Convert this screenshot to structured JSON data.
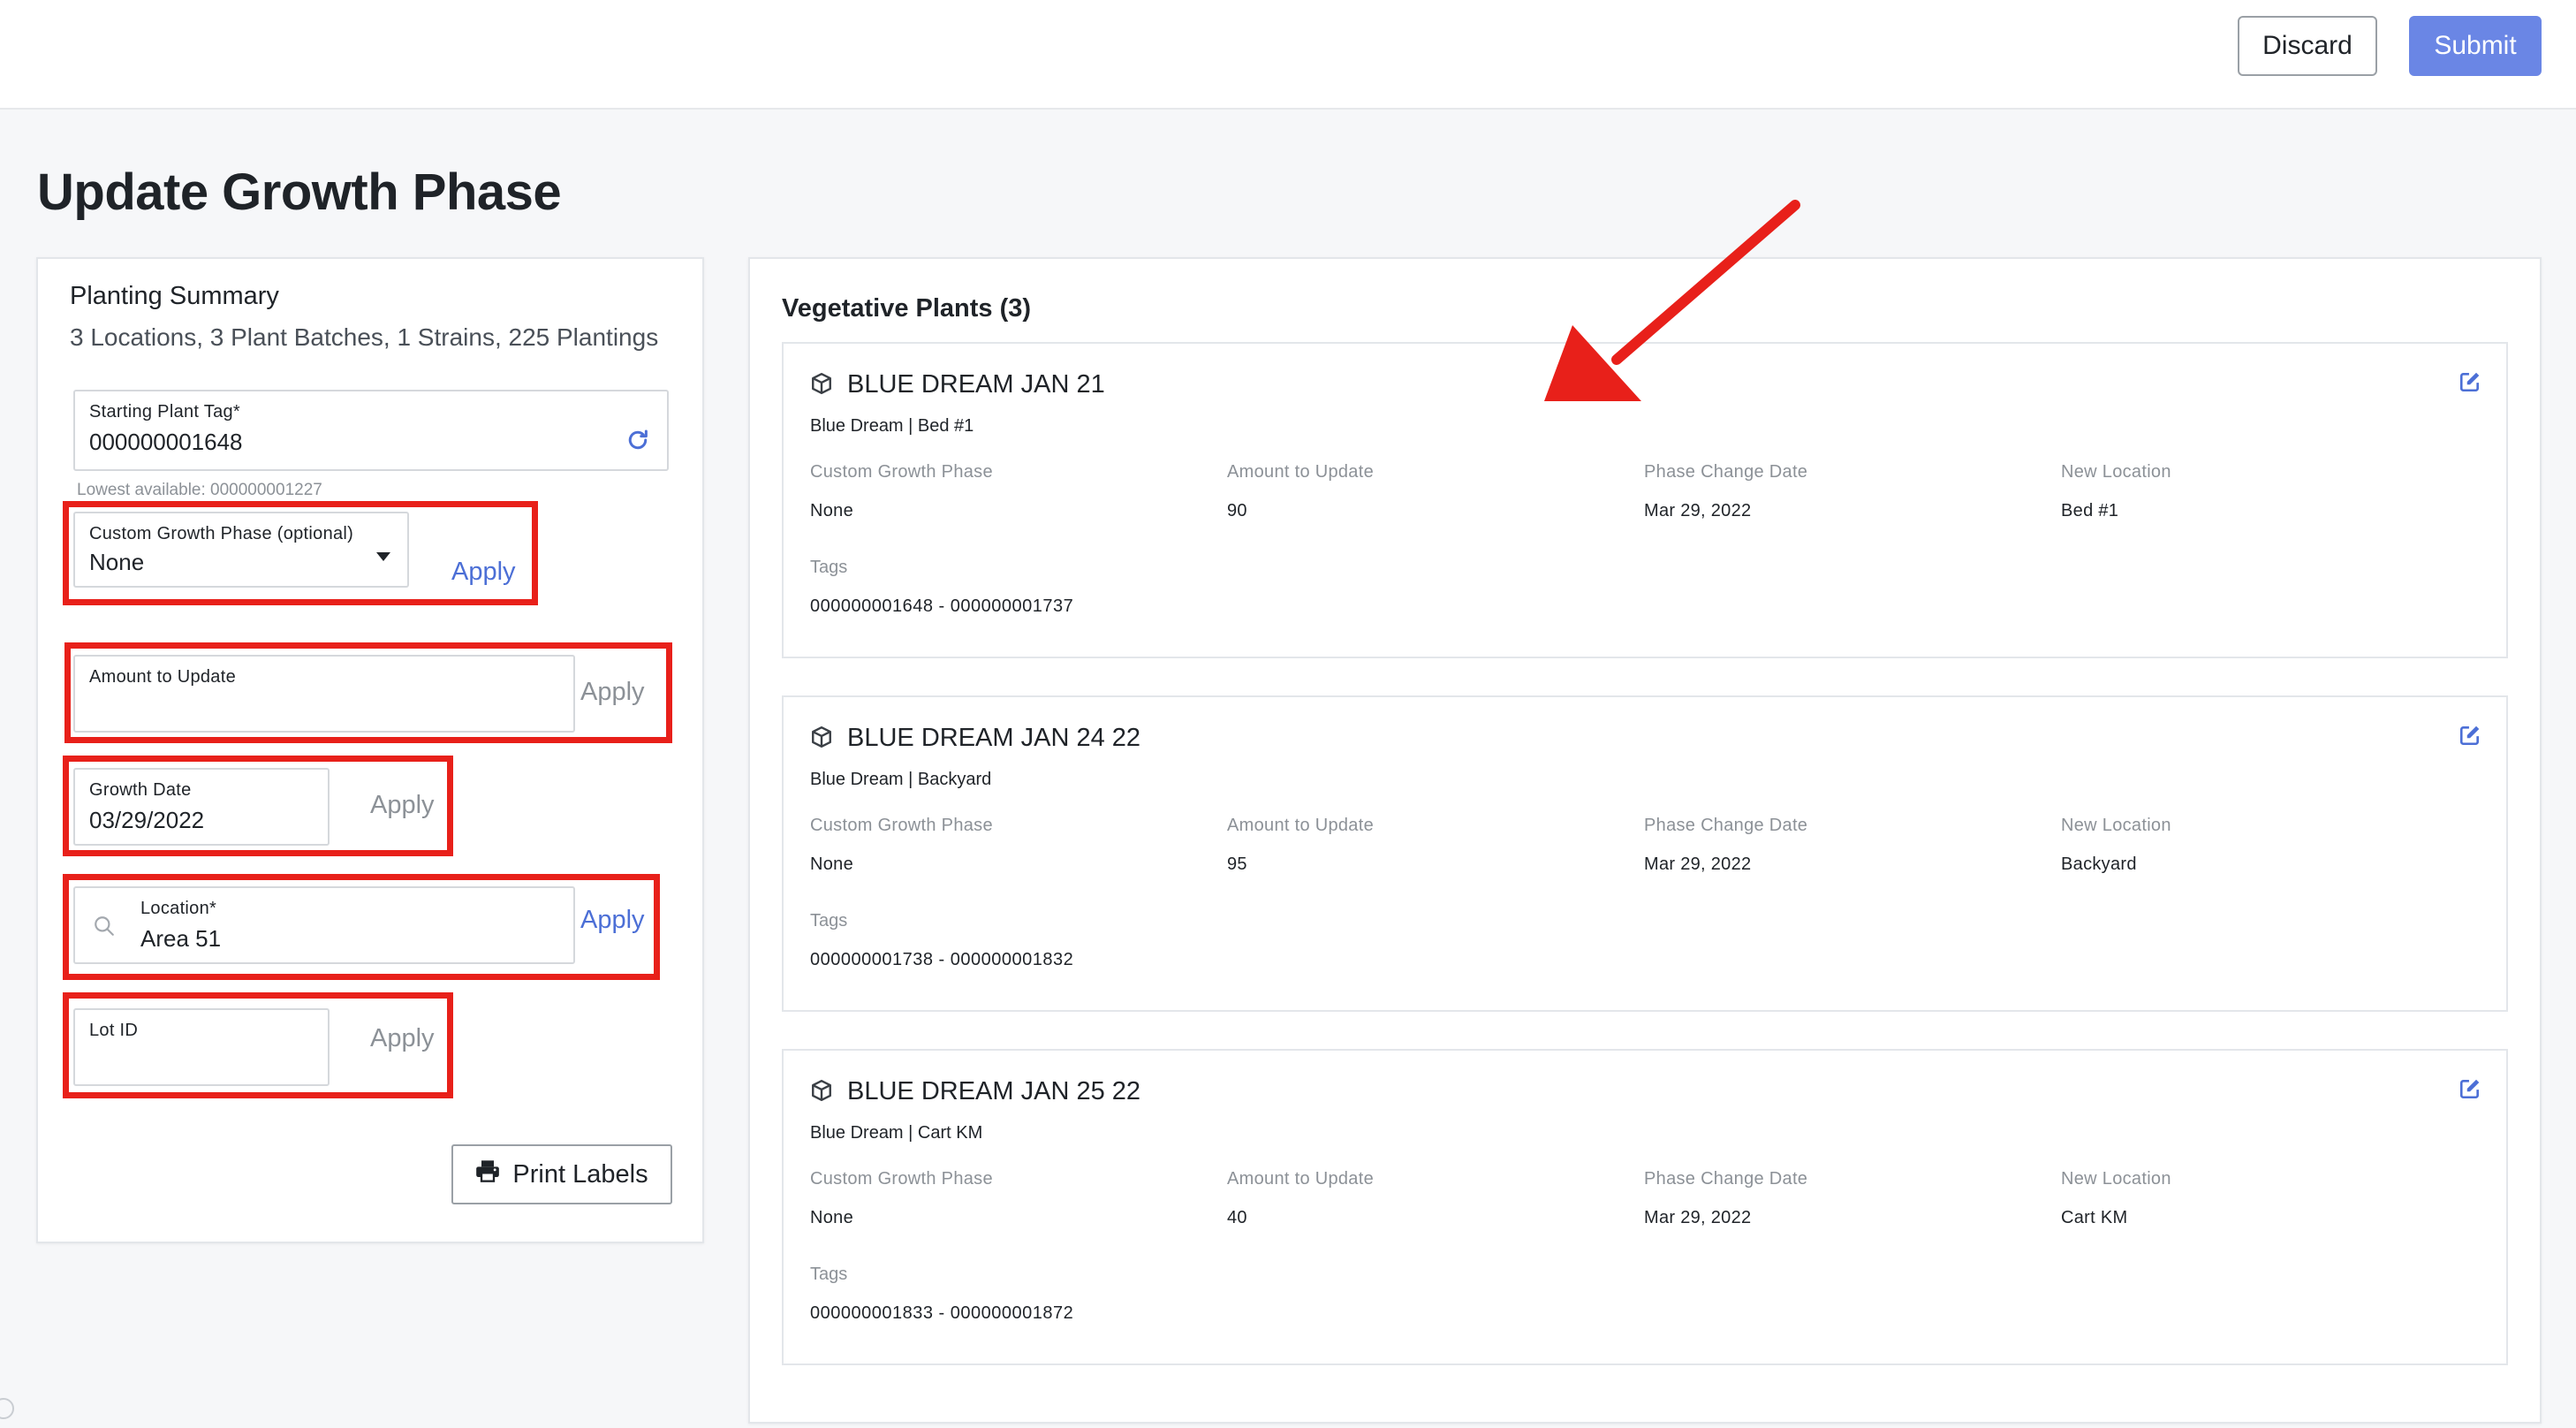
{
  "header": {
    "discard_label": "Discard",
    "submit_label": "Submit"
  },
  "page": {
    "title": "Update Growth Phase"
  },
  "summary": {
    "title": "Planting Summary",
    "text": "3 Locations, 3 Plant Batches, 1 Strains, 225 Plantings"
  },
  "form": {
    "starting_tag": {
      "label": "Starting Plant Tag*",
      "value": "000000001648",
      "hint": "Lowest available: 000000001227"
    },
    "custom_phase": {
      "label": "Custom Growth Phase (optional)",
      "value": "None",
      "apply": "Apply"
    },
    "amount": {
      "label": "Amount to Update",
      "value": "",
      "apply": "Apply"
    },
    "growth_date": {
      "label": "Growth Date",
      "value": "03/29/2022",
      "apply": "Apply"
    },
    "location": {
      "label": "Location*",
      "value": "Area 51",
      "apply": "Apply"
    },
    "lot_id": {
      "label": "Lot ID",
      "value": "",
      "apply": "Apply"
    },
    "print_label": "Print Labels"
  },
  "vegetative": {
    "title": "Vegetative Plants (3)",
    "columns": [
      "Custom Growth Phase",
      "Amount to Update",
      "Phase Change Date",
      "New Location"
    ],
    "tags_label": "Tags",
    "cards": [
      {
        "title": "BLUE DREAM JAN 21",
        "subtitle": "Blue Dream | Bed #1",
        "phase": "None",
        "amount": "90",
        "date": "Mar 29, 2022",
        "location": "Bed #1",
        "tags": "000000001648 - 000000001737"
      },
      {
        "title": "BLUE DREAM JAN 24 22",
        "subtitle": "Blue Dream | Backyard",
        "phase": "None",
        "amount": "95",
        "date": "Mar 29, 2022",
        "location": "Backyard",
        "tags": "000000001738 - 000000001832"
      },
      {
        "title": "BLUE DREAM JAN 25 22",
        "subtitle": "Blue Dream | Cart KM",
        "phase": "None",
        "amount": "40",
        "date": "Mar 29, 2022",
        "location": "Cart KM",
        "tags": "000000001833 - 000000001872"
      }
    ]
  },
  "colors": {
    "accent": "#6a86e5",
    "link": "#4c6fd6",
    "highlight": "#e8201a"
  },
  "icons": [
    "refresh-icon",
    "caret-down-icon",
    "search-icon",
    "printer-icon",
    "box-icon",
    "edit-icon"
  ]
}
